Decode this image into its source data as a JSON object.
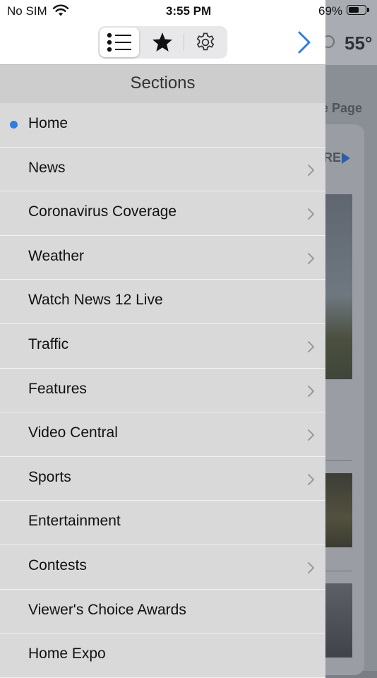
{
  "status_bar": {
    "carrier": "No SIM",
    "time": "3:55 PM",
    "battery_percent": "69%",
    "battery_level": 0.69
  },
  "background": {
    "temperature": "55°",
    "page_label": "e Page",
    "more_label": "RE"
  },
  "toolbar": {
    "segments": [
      {
        "icon": "list-icon",
        "selected": true
      },
      {
        "icon": "star-icon",
        "selected": false
      },
      {
        "icon": "gear-icon",
        "selected": false
      }
    ],
    "forward_icon": "chevron-right-icon",
    "accent_color": "#2f7de1"
  },
  "sections": {
    "title": "Sections",
    "items": [
      {
        "label": "Home",
        "active": true,
        "has_chevron": false
      },
      {
        "label": "News",
        "active": false,
        "has_chevron": true
      },
      {
        "label": "Coronavirus Coverage",
        "active": false,
        "has_chevron": true
      },
      {
        "label": "Weather",
        "active": false,
        "has_chevron": true
      },
      {
        "label": "Watch News 12 Live",
        "active": false,
        "has_chevron": false
      },
      {
        "label": "Traffic",
        "active": false,
        "has_chevron": true
      },
      {
        "label": "Features",
        "active": false,
        "has_chevron": true
      },
      {
        "label": "Video Central",
        "active": false,
        "has_chevron": true
      },
      {
        "label": "Sports",
        "active": false,
        "has_chevron": true
      },
      {
        "label": "Entertainment",
        "active": false,
        "has_chevron": false
      },
      {
        "label": "Contests",
        "active": false,
        "has_chevron": true
      },
      {
        "label": "Viewer's Choice Awards",
        "active": false,
        "has_chevron": false
      },
      {
        "label": "Home Expo",
        "active": false,
        "has_chevron": false
      }
    ]
  }
}
